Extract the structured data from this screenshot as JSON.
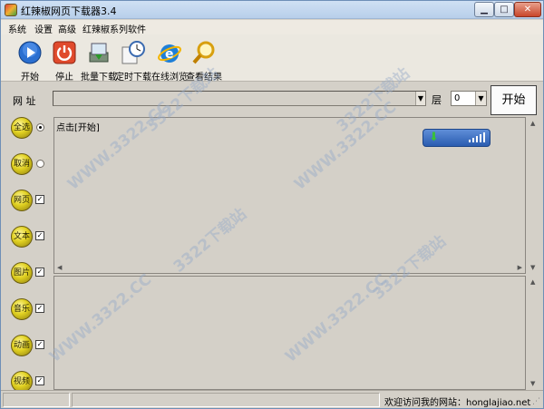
{
  "window": {
    "title": "红辣椒网页下载器3.4",
    "minimize_icon": "minimize-icon",
    "maximize_icon": "maximize-icon",
    "close_icon": "close-icon"
  },
  "menu": [
    "系统",
    "设置",
    "高级",
    "红辣椒系列软件"
  ],
  "toolbar": [
    {
      "label": "开始",
      "icon": "play-icon"
    },
    {
      "label": "停止",
      "icon": "power-icon"
    },
    {
      "label": "批量下载",
      "icon": "batch-download-icon"
    },
    {
      "label": "定时下载",
      "icon": "clock-icon"
    },
    {
      "label": "在线浏览",
      "icon": "ie-browser-icon"
    },
    {
      "label": "查看结果",
      "icon": "magnifier-icon"
    }
  ],
  "url": {
    "label": "网 址",
    "value": "",
    "layer_label": "层",
    "layer_value": "0",
    "start_label": "开始"
  },
  "options": [
    {
      "label": "全选",
      "control": "radio",
      "checked": true
    },
    {
      "label": "取消",
      "control": "radio",
      "checked": false
    },
    {
      "label": "网页",
      "control": "checkbox",
      "checked": true
    },
    {
      "label": "文本",
      "control": "checkbox",
      "checked": true
    },
    {
      "label": "图片",
      "control": "checkbox",
      "checked": true
    },
    {
      "label": "音乐",
      "control": "checkbox",
      "checked": true
    },
    {
      "label": "动画",
      "control": "checkbox",
      "checked": true
    },
    {
      "label": "视频",
      "control": "checkbox",
      "checked": true
    }
  ],
  "log": {
    "text": "点击[开始]"
  },
  "status": {
    "welcome": "欢迎访问我的网站：honglajiao.net"
  },
  "watermark": "WWW.3322.CC",
  "watermark2": "3322下载站",
  "colors": {
    "accent": "#2a5cb0",
    "title_bar": "#cfe0f4",
    "ball": "#e0d020"
  }
}
